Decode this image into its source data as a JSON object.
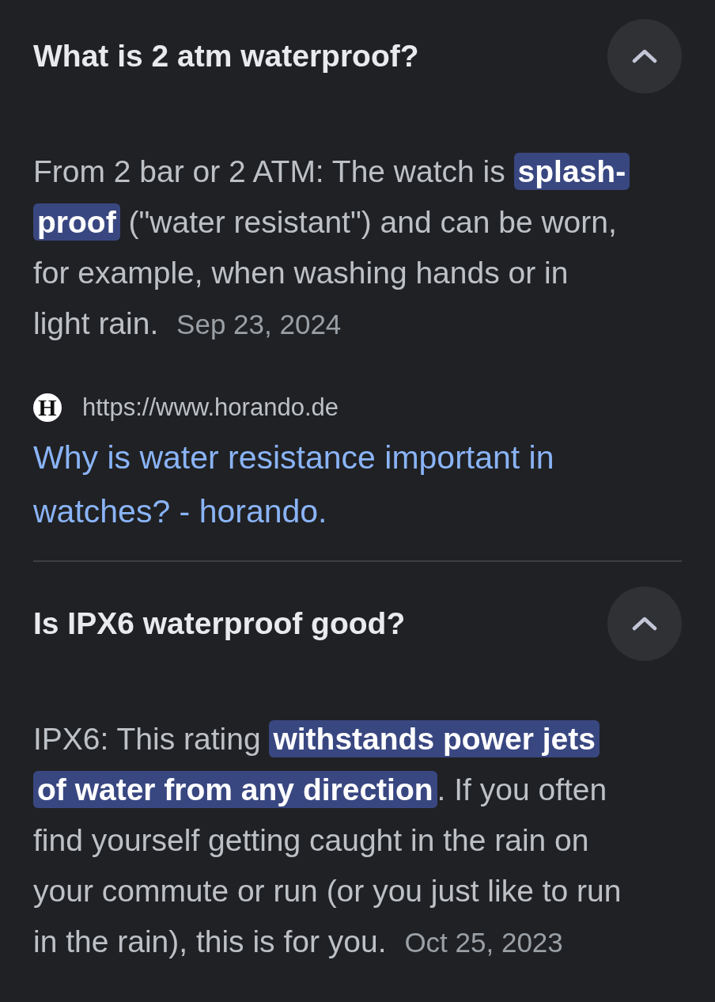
{
  "faqs": [
    {
      "question": "What is 2 atm waterproof?",
      "expanded": true,
      "answer": "From 2 bar or 2 ATM: The watch is **splash-proof** (\"water resistant\") and can be worn, for example, when washing hands or in light rain.",
      "date": "Sep 23, 2024",
      "source": {
        "favicon_letter": "H",
        "url": "https://www.horando.de",
        "title": "Why is water resistance important in watches? - horando."
      }
    },
    {
      "question": "Is IPX6 waterproof good?",
      "expanded": true,
      "answer": "IPX6: This rating **withstands power jets of water from any direction**. If you often find yourself getting caught in the rain on your commute or run (or you just like to run in the rain), this is for you.",
      "date": "Oct 25, 2023"
    }
  ]
}
